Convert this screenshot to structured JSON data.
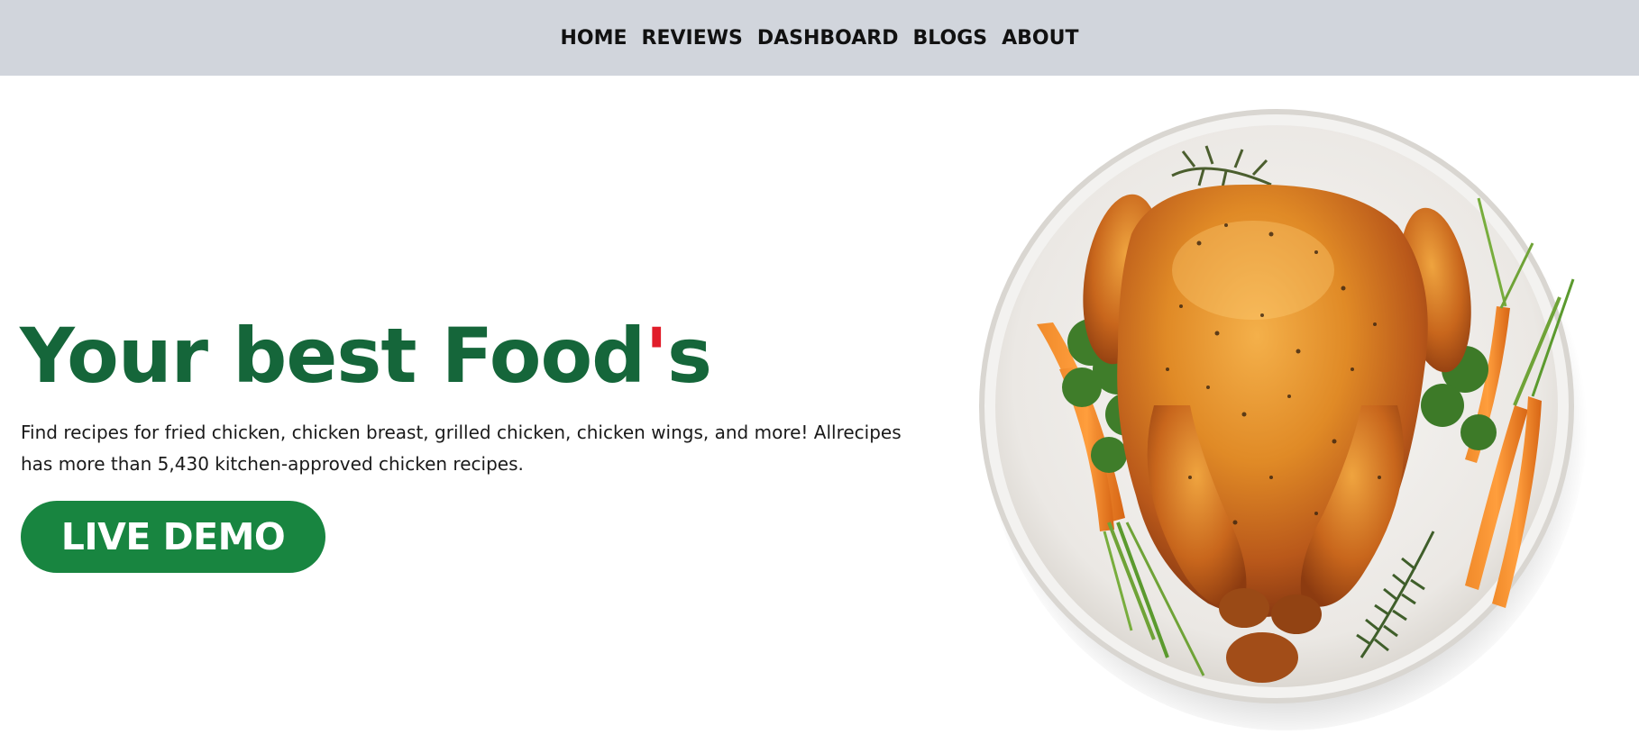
{
  "nav": {
    "items": [
      {
        "label": "HOME"
      },
      {
        "label": "REVIEWS"
      },
      {
        "label": "DASHBOARD"
      },
      {
        "label": "BLOGS"
      },
      {
        "label": "ABOUT"
      }
    ]
  },
  "hero": {
    "title_main": "Your best Food",
    "title_apostrophe": "'",
    "title_suffix": "s",
    "description": "Find recipes for fried chicken, chicken breast, grilled chicken, chicken wings, and more! Allrecipes has more than 5,430 kitchen-approved chicken recipes.",
    "cta_label": "LIVE DEMO"
  },
  "colors": {
    "nav_background": "#d1d5dc",
    "title_green": "#15663a",
    "apostrophe_red": "#e11d2a",
    "button_green": "#188540"
  },
  "image": {
    "subject": "roast-chicken-plate"
  }
}
